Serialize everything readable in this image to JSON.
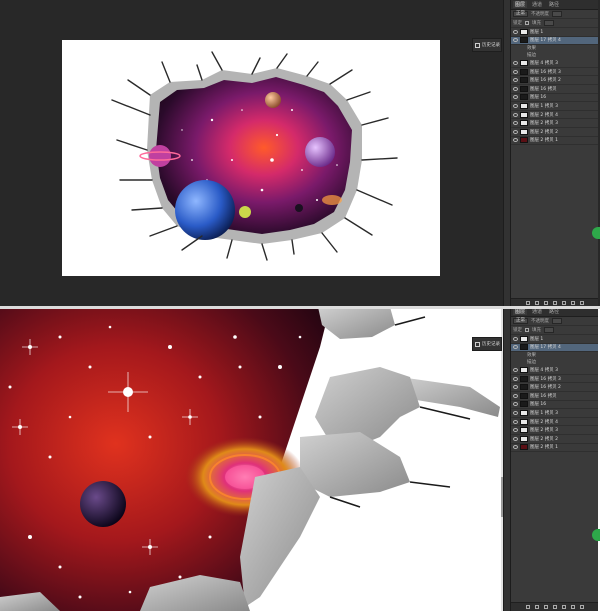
{
  "top_panel": {
    "tabs": [
      "图层",
      "通道",
      "路径"
    ],
    "blend_mode": "正常",
    "opacity_label": "不透明度",
    "lock_label": "锁定",
    "fill_label": "填充",
    "history_label": "历史记录",
    "layers": [
      {
        "name": "图层 1",
        "kind": "normal"
      },
      {
        "name": "图层 17 拷贝 4",
        "kind": "mask",
        "selected": true
      },
      {
        "name": "效果",
        "kind": "fx"
      },
      {
        "name": "描边",
        "kind": "fx"
      },
      {
        "name": "图层 4 拷贝 3",
        "kind": "normal"
      },
      {
        "name": "图层 16 拷贝 3",
        "kind": "mask"
      },
      {
        "name": "图层 16 拷贝 2",
        "kind": "mask"
      },
      {
        "name": "图层 16 拷贝",
        "kind": "mask"
      },
      {
        "name": "图层 16",
        "kind": "mask"
      },
      {
        "name": "图层 1 拷贝 3",
        "kind": "normal"
      },
      {
        "name": "图层 2 拷贝 4",
        "kind": "normal"
      },
      {
        "name": "图层 2 拷贝 3",
        "kind": "normal"
      },
      {
        "name": "图层 2 拷贝 2",
        "kind": "normal"
      },
      {
        "name": "图层 2 拷贝 1",
        "kind": "dark"
      }
    ]
  },
  "bottom_panel": {
    "tabs": [
      "图层",
      "通道",
      "路径"
    ],
    "blend_mode": "正常",
    "opacity_label": "不透明度",
    "lock_label": "锁定",
    "fill_label": "填充",
    "history_label": "历史记录",
    "layers": [
      {
        "name": "图层 1",
        "kind": "normal"
      },
      {
        "name": "图层 17 拷贝 4",
        "kind": "mask",
        "selected": true
      },
      {
        "name": "效果",
        "kind": "fx"
      },
      {
        "name": "描边",
        "kind": "fx"
      },
      {
        "name": "图层 4 拷贝 3",
        "kind": "normal"
      },
      {
        "name": "图层 16 拷贝 3",
        "kind": "mask"
      },
      {
        "name": "图层 16 拷贝 2",
        "kind": "mask"
      },
      {
        "name": "图层 16 拷贝",
        "kind": "mask"
      },
      {
        "name": "图层 16",
        "kind": "mask"
      },
      {
        "name": "图层 1 拷贝 3",
        "kind": "normal"
      },
      {
        "name": "图层 2 拷贝 4",
        "kind": "normal"
      },
      {
        "name": "图层 2 拷贝 3",
        "kind": "normal"
      },
      {
        "name": "图层 2 拷贝 2",
        "kind": "normal"
      },
      {
        "name": "图层 2 拷贝 1",
        "kind": "dark"
      }
    ]
  },
  "colors": {
    "workspace": "#282828",
    "panel": "#3a3a3a",
    "selection": "#52667c",
    "accent_green": "#2ea84a"
  }
}
